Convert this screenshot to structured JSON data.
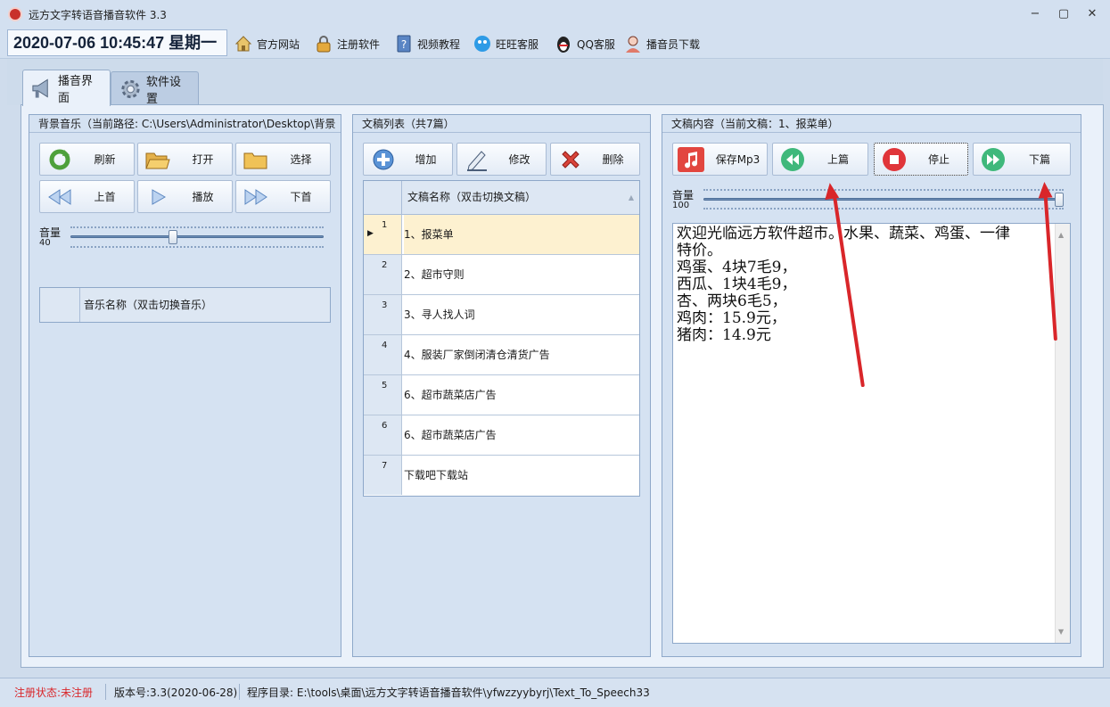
{
  "window": {
    "title": "远方文字转语音播音软件 3.3",
    "minimize": "−",
    "maximize": "▢",
    "close": "✕"
  },
  "toolbar": {
    "datetime": "2020-07-06 10:45:47 星期一",
    "items": [
      {
        "label": "官方网站",
        "icon": "home-icon",
        "color": "#c9a24a"
      },
      {
        "label": "注册软件",
        "icon": "lock-icon",
        "color": "#d9a23a"
      },
      {
        "label": "视频教程",
        "icon": "help-book-icon",
        "color": "#4b78b8"
      },
      {
        "label": "旺旺客服",
        "icon": "wangwang-icon",
        "color": "#2e9be6"
      },
      {
        "label": "QQ客服",
        "icon": "qq-penguin-icon",
        "color": "#222222"
      },
      {
        "label": "播音员下载",
        "icon": "announcer-icon",
        "color": "#e07a6a"
      }
    ]
  },
  "tabs": [
    {
      "label": "播音界面",
      "icon": "megaphone-icon",
      "active": true
    },
    {
      "label": "软件设置",
      "icon": "gear-icon",
      "active": false
    }
  ],
  "music_panel": {
    "title": "背景音乐（当前路径: C:\\Users\\Administrator\\Desktop\\背景",
    "buttons": [
      {
        "label": "刷新",
        "icon": "refresh-icon"
      },
      {
        "label": "打开",
        "icon": "open-folder-icon"
      },
      {
        "label": "选择",
        "icon": "folder-icon"
      },
      {
        "label": "上首",
        "icon": "rewind-icon"
      },
      {
        "label": "播放",
        "icon": "play-icon"
      },
      {
        "label": "下首",
        "icon": "fast-forward-icon"
      }
    ],
    "volume_label": "音量",
    "volume_value": "40",
    "volume_level": 0.4,
    "grid_header": "音乐名称（双击切换音乐）"
  },
  "doc_panel": {
    "title": "文稿列表（共7篇）",
    "buttons": [
      {
        "label": "增加",
        "icon": "add-icon"
      },
      {
        "label": "修改",
        "icon": "edit-pencil-icon"
      },
      {
        "label": "删除",
        "icon": "delete-x-icon"
      }
    ],
    "grid_header": "文稿名称（双击切换文稿）",
    "sort_indicator": "▲",
    "row_pointer": "▶",
    "rows": [
      {
        "num": "1",
        "name": "1、报菜单",
        "selected": true
      },
      {
        "num": "2",
        "name": "2、超市守则",
        "selected": false
      },
      {
        "num": "3",
        "name": "3、寻人找人词",
        "selected": false
      },
      {
        "num": "4",
        "name": "4、服装厂家倒闭清仓清货广告",
        "selected": false
      },
      {
        "num": "5",
        "name": "6、超市蔬菜店广告",
        "selected": false
      },
      {
        "num": "6",
        "name": "6、超市蔬菜店广告",
        "selected": false
      },
      {
        "num": "7",
        "name": "下载吧下载站",
        "selected": false
      }
    ]
  },
  "content_panel": {
    "title": "文稿内容（当前文稿：1、报菜单）",
    "buttons": [
      {
        "label": "保存Mp3",
        "icon": "music-note-icon"
      },
      {
        "label": "上篇",
        "icon": "previous-icon"
      },
      {
        "label": "停止",
        "icon": "stop-icon"
      },
      {
        "label": "下篇",
        "icon": "next-icon"
      }
    ],
    "volume_label": "音量",
    "volume_value": "100",
    "volume_level": 1.0,
    "text_lines": [
      "欢迎光临远方软件超市。水果、蔬菜、鸡蛋、一律",
      "特价。",
      "鸡蛋、4块7毛9，",
      "西瓜、1块4毛9，",
      "杏、两块6毛5，",
      "鸡肉：15.9元，",
      "猪肉：14.9元"
    ]
  },
  "statusbar": {
    "reg_status": "注册状态:未注册",
    "version": "版本号:3.3(2020-06-28)",
    "program_dir": "程序目录: E:\\tools\\桌面\\远方文字转语音播音软件\\yfwzzyybyrj\\Text_To_Speech33"
  },
  "colors": {
    "accent_red": "#d9262a",
    "selected_row": "#fdf1d0",
    "status_red": "#d9262a"
  }
}
